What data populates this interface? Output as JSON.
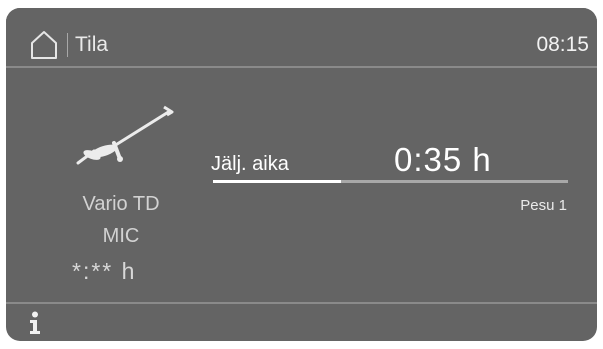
{
  "header": {
    "title": "Tila",
    "time": "08:15",
    "home_icon": "home-icon"
  },
  "program": {
    "icon": "dishwasher-rack-icon",
    "name_line1": "Vario TD",
    "name_line2": "MIC",
    "duration": "*:** h"
  },
  "status": {
    "remaining_label": "Jälj. aika",
    "remaining_value": "0:35 h",
    "progress_fraction": 0.36,
    "phase": "Pesu 1"
  },
  "footer": {
    "info_icon": "info-icon"
  },
  "colors": {
    "screen_background": "#646464",
    "divider": "#8a8a8a",
    "text": "#ffffff",
    "text_dim": "#d2d2d2",
    "progress_track": "#a8a8a8",
    "progress_fill": "#ffffff"
  }
}
